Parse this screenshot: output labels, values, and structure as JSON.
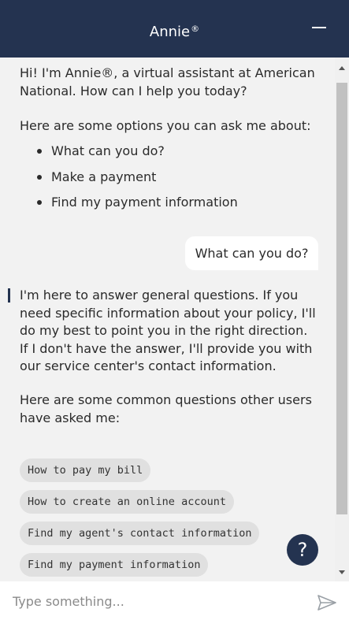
{
  "header": {
    "title": "Annie",
    "title_mark": "®",
    "minimize_icon": "minus-icon"
  },
  "messages": {
    "greeting": "Hi! I'm Annie®, a virtual assistant at American National. How can I help you today?",
    "options_intro": "Here are some options you can ask me about:",
    "options": [
      "What can you do?",
      "Make a payment",
      "Find my payment information"
    ],
    "user_message": "What can you do?",
    "bot_reply": "I'm here to answer general questions. If you need specific information about your policy, I'll do my best to point you in the right direction. If I don't have the answer, I'll provide you with our service center's contact information.",
    "common_intro": "Here are some common questions other users have asked me:",
    "suggestions": [
      "How to pay my bill",
      "How to create an online account",
      "Find my agent's contact information",
      "Find my payment information"
    ]
  },
  "help_button": {
    "label": "?",
    "icon": "question-icon"
  },
  "composer": {
    "placeholder": "Type something...",
    "value": "",
    "send_icon": "send-icon"
  },
  "colors": {
    "header_bg": "#243350",
    "chat_bg": "#f2f2f2",
    "chip_bg": "#e0e0e0",
    "accent": "#243350"
  }
}
